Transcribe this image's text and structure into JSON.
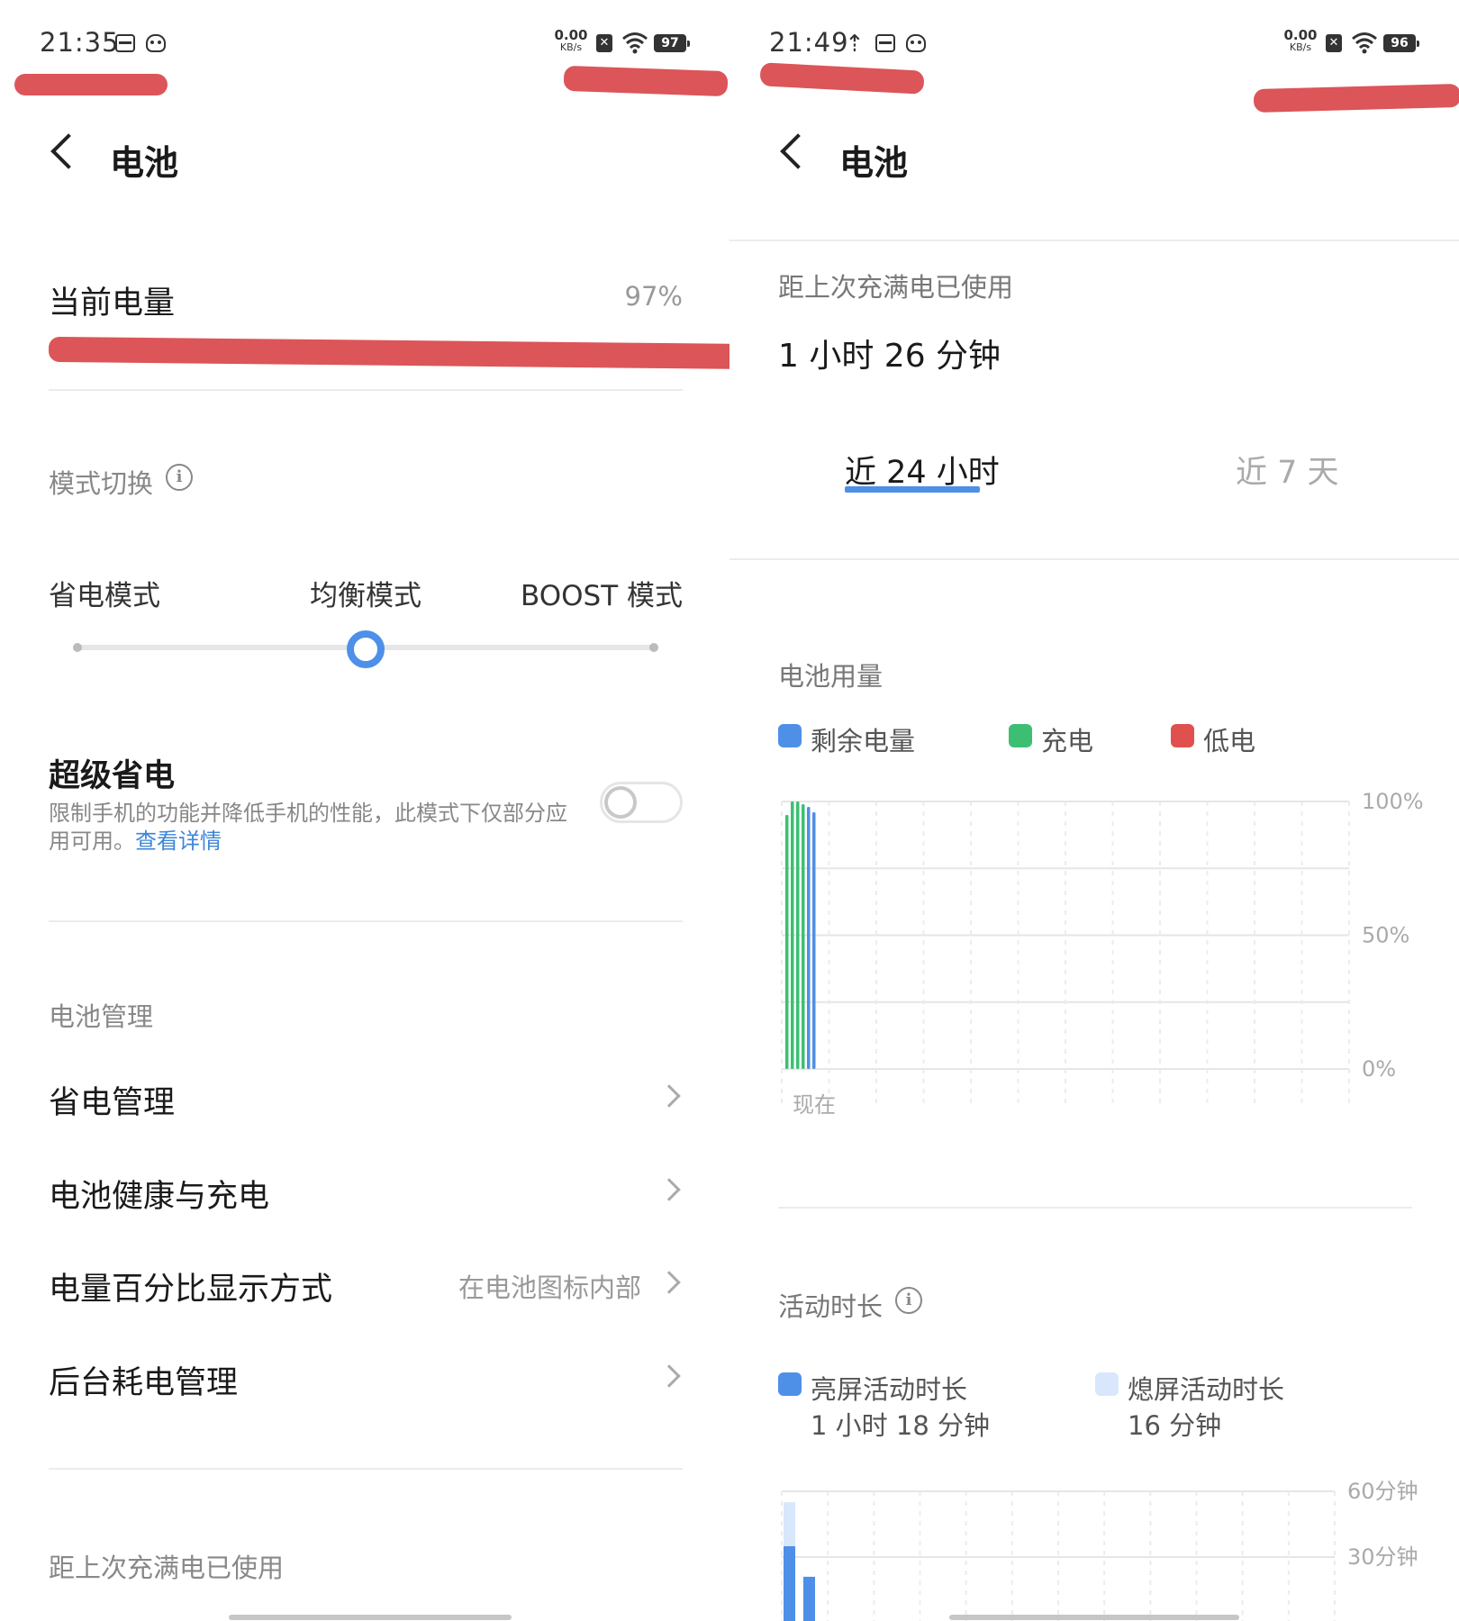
{
  "left": {
    "status": {
      "time": "21:35",
      "speed_value": "0.00",
      "speed_unit": "KB/s",
      "battery": "97"
    },
    "header": {
      "title": "电池"
    },
    "current_charge": {
      "label": "当前电量",
      "value": "97%"
    },
    "mode": {
      "heading": "模式切换",
      "options": [
        "省电模式",
        "均衡模式",
        "BOOST 模式"
      ],
      "selected": "均衡模式"
    },
    "super_saver": {
      "title": "超级省电",
      "description": "限制手机的功能并降低手机的性能，此模式下仅部分应用可用。",
      "link": "查看详情",
      "enabled": false
    },
    "management": {
      "heading": "电池管理",
      "items": [
        {
          "label": "省电管理",
          "value": ""
        },
        {
          "label": "电池健康与充电",
          "value": ""
        },
        {
          "label": "电量百分比显示方式",
          "value": "在电池图标内部"
        },
        {
          "label": "后台耗电管理",
          "value": ""
        }
      ]
    },
    "since_full": {
      "label": "距上次充满电已使用"
    }
  },
  "right": {
    "status": {
      "time": "21:49",
      "speed_value": "0.00",
      "speed_unit": "KB/s",
      "battery": "96"
    },
    "header": {
      "title": "电池"
    },
    "since_full": {
      "label": "距上次充满电已使用",
      "value": "1 小时 26 分钟"
    },
    "tabs": [
      {
        "label": "近 24 小时",
        "active": true
      },
      {
        "label": "近 7 天",
        "active": false
      }
    ],
    "usage_chart": {
      "title": "电池用量",
      "legend": [
        {
          "label": "剩余电量",
          "color": "#4e8fe8"
        },
        {
          "label": "充电",
          "color": "#3cbf73"
        },
        {
          "label": "低电",
          "color": "#e0504e"
        }
      ],
      "x_label_now": "现在"
    },
    "activity": {
      "title": "活动时长",
      "legend": [
        {
          "label": "亮屏活动时长",
          "value": "1 小时 18 分钟",
          "color": "#4e8fe8"
        },
        {
          "label": "熄屏活动时长",
          "value": "16 分钟",
          "color": "#d8e7fb"
        }
      ]
    }
  },
  "chart_data": [
    {
      "type": "bar",
      "title": "电池用量",
      "x": [
        "现在"
      ],
      "ylim": [
        0,
        100
      ],
      "y_ticks": [
        "100%",
        "50%",
        "0%"
      ],
      "grid": true,
      "legend_placement": "top-left",
      "series": [
        {
          "name": "充电",
          "color": "#3cbf73",
          "values": [
            95,
            100,
            100,
            99
          ]
        },
        {
          "name": "剩余电量",
          "color": "#4e8fe8",
          "values": [
            98,
            96
          ]
        }
      ]
    },
    {
      "type": "bar",
      "title": "活动时长",
      "ylim": [
        0,
        60
      ],
      "y_ticks": [
        "60分钟",
        "30分钟"
      ],
      "grid": true,
      "legend_placement": "top-left",
      "series": [
        {
          "name": "亮屏活动时长",
          "color": "#4e8fe8",
          "values": [
            35,
            21
          ]
        },
        {
          "name": "熄屏活动时长",
          "color": "#d8e7fb",
          "values": [
            20,
            0
          ]
        }
      ]
    }
  ]
}
